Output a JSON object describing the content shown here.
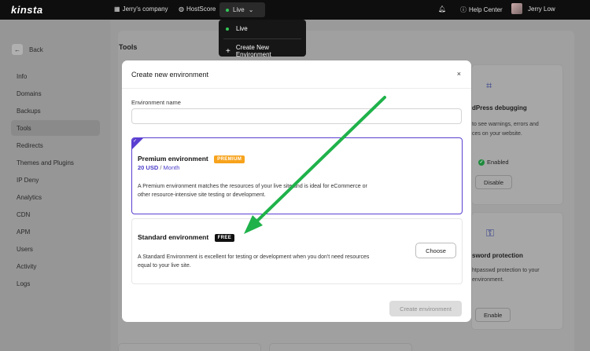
{
  "topbar": {
    "logo": "kinsta",
    "company": "Jerry's company",
    "hostscore": "HostScore",
    "env": "Live",
    "help": "Help Center",
    "user": "Jerry Low"
  },
  "env_menu": {
    "current": "Live",
    "create": "Create New Environment"
  },
  "sidebar": {
    "back": "Back",
    "items": [
      "Info",
      "Domains",
      "Backups",
      "Tools",
      "Redirects",
      "Themes and Plugins",
      "IP Deny",
      "Analytics",
      "CDN",
      "APM",
      "Users",
      "Activity",
      "Logs"
    ],
    "active": "Tools"
  },
  "main": {
    "title": "Tools",
    "card1": {
      "title": "dPress debugging",
      "text1": "to see warnings, errors and",
      "text2": "ces on your website.",
      "status": "Enabled",
      "button": "Disable"
    },
    "card2": {
      "title": "sword protection",
      "text1": "htpasswd protection to your",
      "text2": "environment.",
      "button": "Enable"
    }
  },
  "modal": {
    "title": "Create new environment",
    "close": "×",
    "field_label": "Environment name",
    "field_value": "",
    "premium": {
      "title": "Premium environment",
      "badge": "PREMIUM",
      "price_amount": "20 USD",
      "price_sep": "/",
      "price_period": "Month",
      "desc1": "A Premium environment matches the resources of your live site and is ideal for eCommerce or",
      "desc2": "other resource-intensive site testing or development."
    },
    "standard": {
      "title": "Standard environment",
      "badge": "FREE",
      "desc1": "A Standard Environment is excellent for testing or development when you don't need resources",
      "desc2": "equal to your live site.",
      "choose": "Choose"
    },
    "create_button": "Create environment"
  },
  "colors": {
    "accent": "#5b3fd1",
    "premium_badge": "#f7a31c",
    "live_dot": "#34c759",
    "annotation_arrow": "#1fb24a"
  }
}
